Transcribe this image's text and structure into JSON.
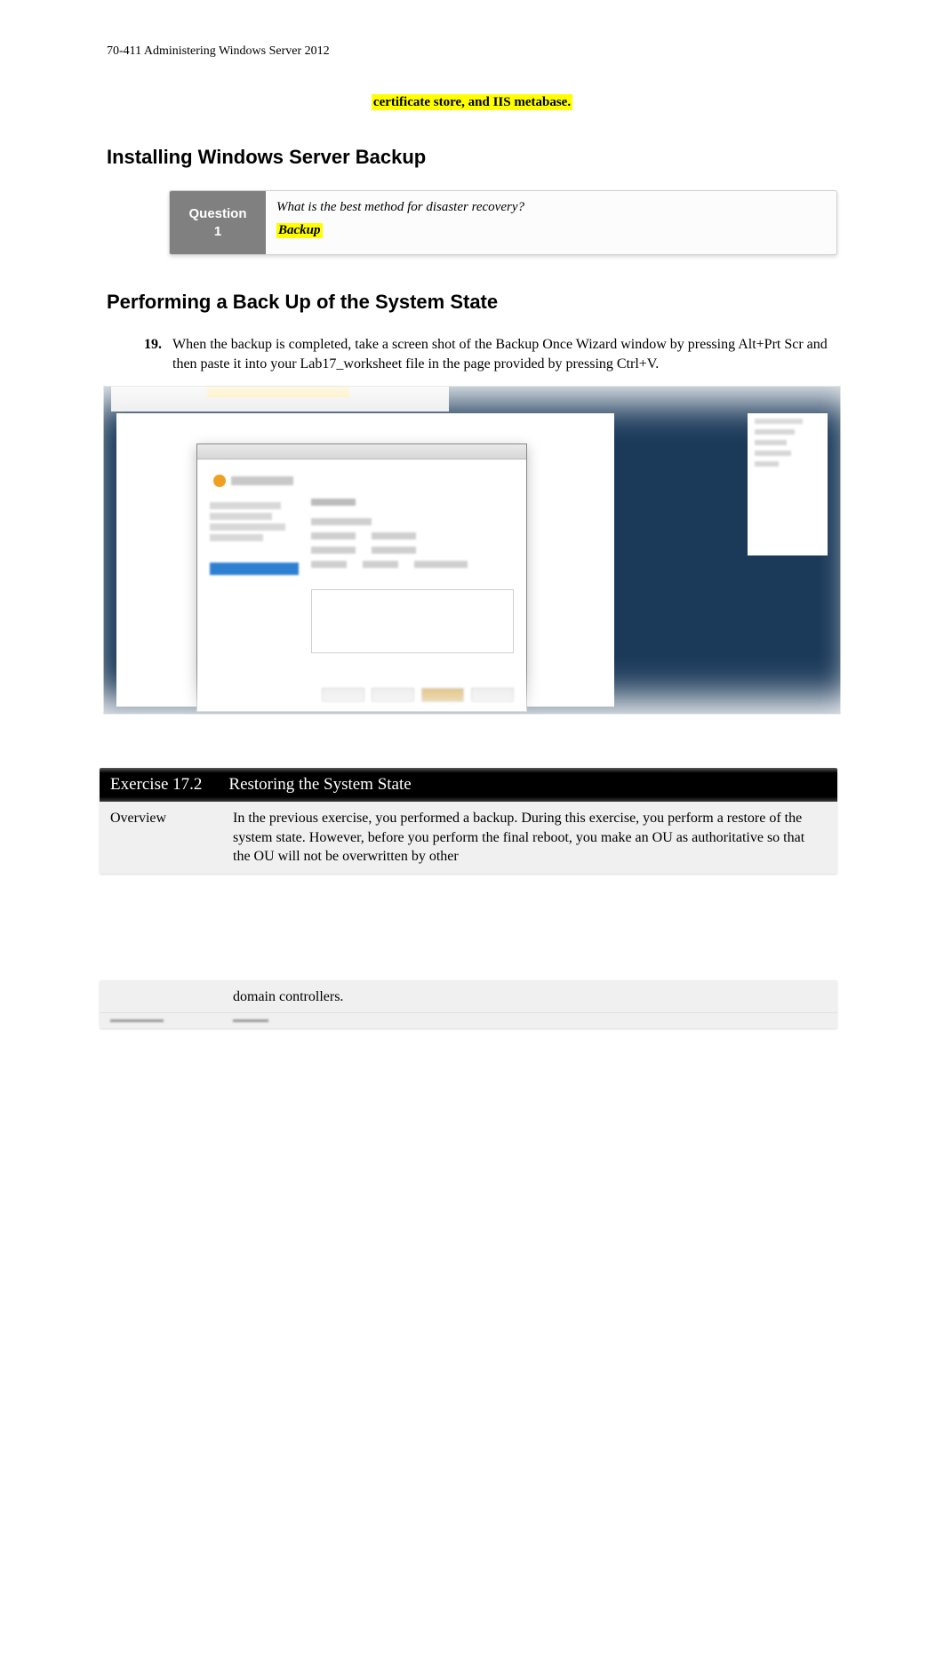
{
  "header": "70-411 Administering Windows Server 2012",
  "fragment": "certificate store, and IIS metabase.",
  "section1": "Installing Windows Server Backup",
  "question": {
    "label_l1": "Question",
    "label_l2": "1",
    "text": "What is the best method for disaster recovery?",
    "answer": "Backup"
  },
  "section2": "Performing a Back Up of the System State",
  "step": {
    "num": "19.",
    "text": "When the backup is completed, take a screen shot of the Backup Once Wizard window by pressing Alt+Prt Scr and then paste it into your Lab17_worksheet file in the page provided by pressing Ctrl+V."
  },
  "exercise": {
    "num": "Exercise 17.2",
    "title": "Restoring the System State",
    "overview_label": "Overview",
    "overview_text": "In the previous exercise, you performed a backup. During this exercise, you perform a restore of the system state. However, before you perform the final reboot, you make an OU as authoritative so that the OU will not be overwritten by other",
    "overview_tail": "domain controllers."
  }
}
